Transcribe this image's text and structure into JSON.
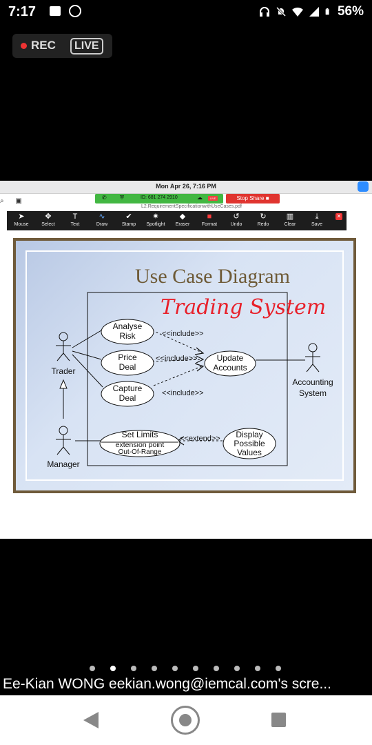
{
  "status": {
    "time": "7:17",
    "battery": "56%"
  },
  "recording": {
    "rec_label": "REC",
    "live_label": "LIVE"
  },
  "screen": {
    "mac_date": "Mon Apr 26,  7:16 PM",
    "meeting_id": "ID: 681 274 2910",
    "live_tag": "LIVE",
    "stop_share": "Stop Share",
    "doc_name": "L2.RequirementSpecificationwithUseCases.pdf",
    "toolbar": [
      {
        "label": "Mouse",
        "icon": "cursor-icon"
      },
      {
        "label": "Select",
        "icon": "move-icon"
      },
      {
        "label": "Text",
        "icon": "text-icon"
      },
      {
        "label": "Draw",
        "icon": "draw-icon"
      },
      {
        "label": "Stamp",
        "icon": "check-icon"
      },
      {
        "label": "Spotlight",
        "icon": "wand-icon"
      },
      {
        "label": "Eraser",
        "icon": "eraser-icon"
      },
      {
        "label": "Format",
        "icon": "format-icon"
      },
      {
        "label": "Undo",
        "icon": "undo-icon"
      },
      {
        "label": "Redo",
        "icon": "redo-icon"
      },
      {
        "label": "Clear",
        "icon": "trash-icon"
      },
      {
        "label": "Save",
        "icon": "save-icon"
      }
    ],
    "slide": {
      "title": "Use Case Diagram",
      "handwriting": "Trading System",
      "actors": {
        "trader": "Trader",
        "manager": "Manager",
        "accounting_line1": "Accounting",
        "accounting_line2": "System"
      },
      "use_cases": {
        "analyse_1": "Analyse",
        "analyse_2": "Risk",
        "price_1": "Price",
        "price_2": "Deal",
        "capture_1": "Capture",
        "capture_2": "Deal",
        "update_1": "Update",
        "update_2": "Accounts",
        "limits_1": "Set Limits",
        "limits_2": "extension point",
        "limits_3": "Out-Of-Range",
        "display_1": "Display",
        "display_2": "Possible",
        "display_3": "Values"
      },
      "relations": {
        "include_1": "<<include>>",
        "include_2": "<<include>>",
        "include_3": "<<include>>",
        "extend": "<<extend>>"
      }
    }
  },
  "pager": {
    "count": 10,
    "active": 1
  },
  "share_caption": "Ee-Kian WONG eekian.wong@iemcal.com's scre...",
  "colors": {
    "rec_red": "#e33333",
    "zoom_green": "#42b742",
    "stop_red": "#e0342f",
    "slide_title": "#6e5a36",
    "handwriting": "#e8202a"
  }
}
